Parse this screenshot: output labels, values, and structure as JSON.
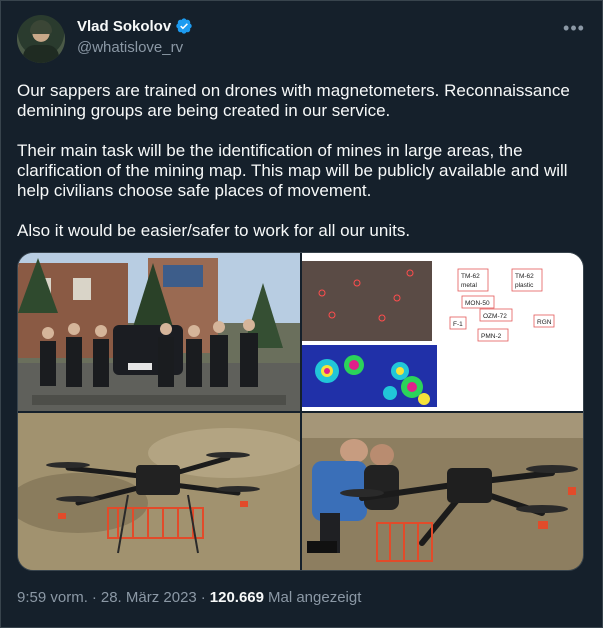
{
  "author": {
    "display_name": "Vlad Sokolov",
    "handle": "@whatislove_rv",
    "verified": true
  },
  "tweet": {
    "paragraphs": [
      "Our sappers are trained on drones with magnetometers. Reconnaissance demining groups are being created in our service.",
      "Their main task will be the identification of mines in large areas, the clarification of the mining map. This map will be publicly available and will help civilians choose safe places of movement.",
      "Also it would be easier/safer to work for all our units."
    ]
  },
  "map_labels": {
    "tm62_metal": "TM-62\nmetal",
    "tm62_plastic": "TM-62\nplastic",
    "mon50": "MON-50",
    "ozm72": "OZM-72",
    "f1": "F-1",
    "rgn": "RGN",
    "pmn2": "PMN-2"
  },
  "footer": {
    "time": "9:59 vorm.",
    "date": "28. März 2023",
    "views": "120.669",
    "views_label": "Mal angezeigt"
  },
  "colors": {
    "background": "#15202b",
    "verified": "#1d9bf0",
    "muted": "#8b98a5"
  }
}
